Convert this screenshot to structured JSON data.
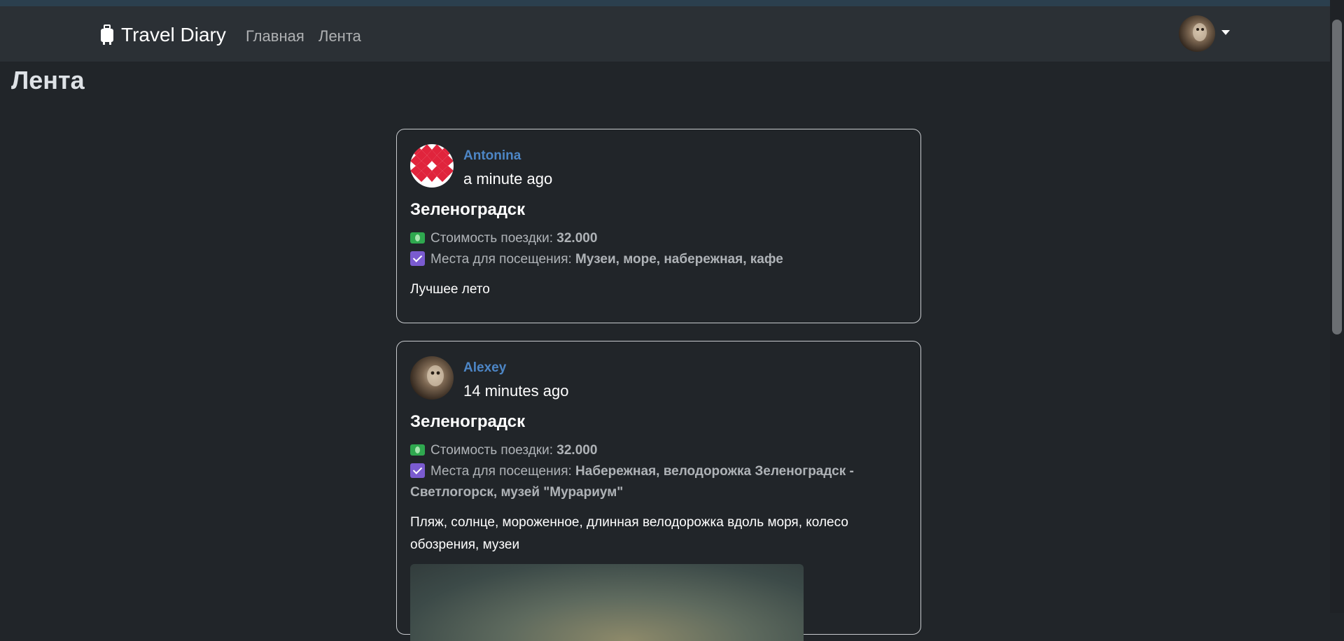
{
  "navbar": {
    "brand": "Travel Diary",
    "links": [
      "Главная",
      "Лента"
    ]
  },
  "page": {
    "title": "Лента"
  },
  "posts": [
    {
      "author": "Antonina",
      "time": "a minute ago",
      "title": "Зеленоградск",
      "cost_label": "Стоимость поездки:",
      "cost_value": "32.000",
      "places_label": "Места для посещения:",
      "places_value": "Музеи, море, набережная, кафе",
      "description": "Лучшее лето"
    },
    {
      "author": "Alexey",
      "time": "14 minutes ago",
      "title": "Зеленоградск",
      "cost_label": "Стоимость поездки:",
      "cost_value": "32.000",
      "places_label": "Места для посещения:",
      "places_value": "Набережная, велодорожка Зеленоградск - Светлогорск, музей \"Мурариум\"",
      "description": "Пляж, солнце, мороженное, длинная велодорожка вдоль моря, колесо обозрения, музеи"
    }
  ],
  "icons": {
    "brand": "suitcase-icon",
    "cost": "money-icon",
    "places": "checkbox-icon",
    "menu": "caret-down-icon"
  },
  "colors": {
    "background": "#212529",
    "navbar": "#2b3035",
    "author_link": "#4d86c6",
    "card_border": "#c8cbce"
  }
}
